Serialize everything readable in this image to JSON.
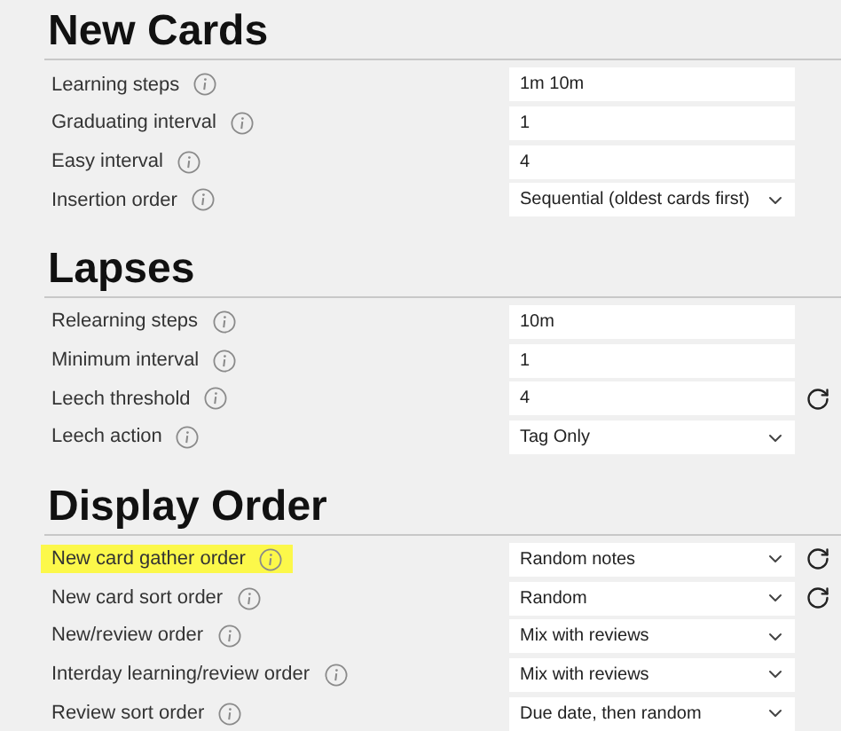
{
  "sections": [
    {
      "title": "New Cards",
      "rows": [
        {
          "label": "Learning steps",
          "kind": "input",
          "value": "1m 10m",
          "highlighted": false,
          "reset": false
        },
        {
          "label": "Graduating interval",
          "kind": "input",
          "value": "1",
          "highlighted": false,
          "reset": false
        },
        {
          "label": "Easy interval",
          "kind": "input",
          "value": "4",
          "highlighted": false,
          "reset": false
        },
        {
          "label": "Insertion order",
          "kind": "select",
          "value": "Sequential (oldest cards first)",
          "highlighted": false,
          "reset": false
        }
      ]
    },
    {
      "title": "Lapses",
      "rows": [
        {
          "label": "Relearning steps",
          "kind": "input",
          "value": "10m",
          "highlighted": false,
          "reset": false
        },
        {
          "label": "Minimum interval",
          "kind": "input",
          "value": "1",
          "highlighted": false,
          "reset": false
        },
        {
          "label": "Leech threshold",
          "kind": "input",
          "value": "4",
          "highlighted": false,
          "reset": true
        },
        {
          "label": "Leech action",
          "kind": "select",
          "value": "Tag Only",
          "highlighted": false,
          "reset": false
        }
      ]
    },
    {
      "title": "Display Order",
      "rows": [
        {
          "label": "New card gather order",
          "kind": "select",
          "value": "Random notes",
          "highlighted": true,
          "reset": true
        },
        {
          "label": "New card sort order",
          "kind": "select",
          "value": "Random",
          "highlighted": false,
          "reset": true
        },
        {
          "label": "New/review order",
          "kind": "select",
          "value": "Mix with reviews",
          "highlighted": false,
          "reset": false
        },
        {
          "label": "Interday learning/review order",
          "kind": "select",
          "value": "Mix with reviews",
          "highlighted": false,
          "reset": false
        },
        {
          "label": "Review sort order",
          "kind": "select",
          "value": "Due date, then random",
          "highlighted": false,
          "reset": false
        }
      ]
    }
  ]
}
